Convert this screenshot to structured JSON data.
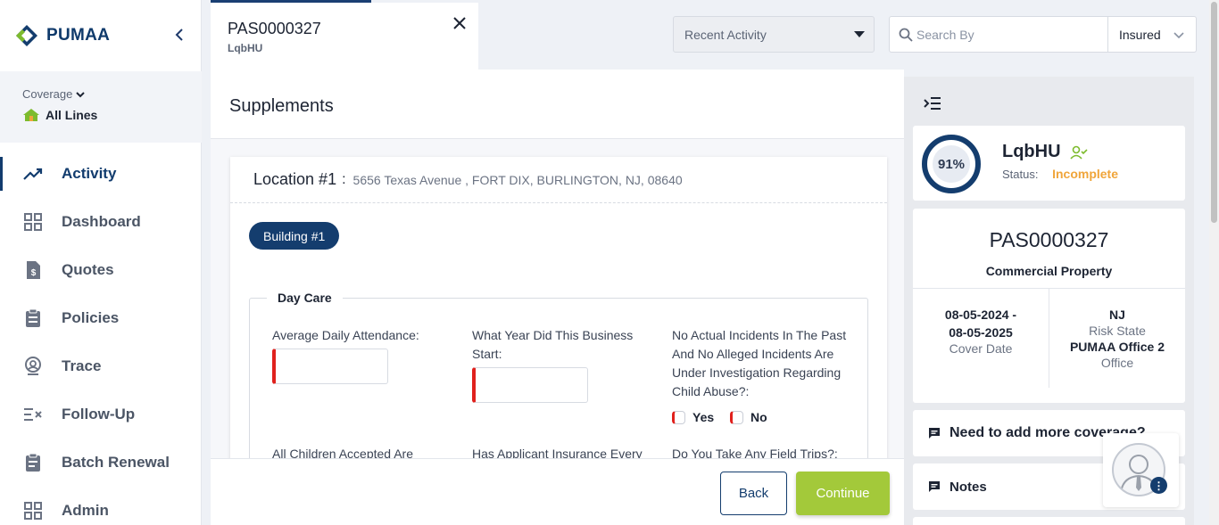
{
  "brand": {
    "name": "PUMAA",
    "colors": {
      "primary": "#143d6e",
      "accent": "#a3c93a",
      "required": "#e0211d",
      "status": "#f0a53a"
    }
  },
  "coverage": {
    "label": "Coverage",
    "value": "All Lines"
  },
  "nav": [
    {
      "label": "Activity",
      "icon": "trend-icon",
      "active": true
    },
    {
      "label": "Dashboard",
      "icon": "grid-icon"
    },
    {
      "label": "Quotes",
      "icon": "document-dollar-icon"
    },
    {
      "label": "Policies",
      "icon": "clipboard-icon"
    },
    {
      "label": "Trace",
      "icon": "location-pin-icon"
    },
    {
      "label": "Follow-Up",
      "icon": "list-check-icon"
    },
    {
      "label": "Batch Renewal",
      "icon": "clipboard-list-icon"
    },
    {
      "label": "Admin",
      "icon": "grid-icon"
    }
  ],
  "tab": {
    "title": "PAS0000327",
    "subtitle": "LqbHU"
  },
  "header": {
    "recent_activity": "Recent Activity",
    "search_placeholder": "Search By",
    "search_type": "Insured"
  },
  "main": {
    "title": "Supplements",
    "location_label": "Location #1",
    "location_colon": ":",
    "location_address": "5656 Texas Avenue , FORT DIX, BURLINGTON, NJ, 08640",
    "building": "Building #1",
    "section": "Day Care",
    "questions": {
      "q1": "Average Daily Attendance:",
      "q2": "What Year Did This Business Start:",
      "q3": "No Actual Incidents In The Past And No Alleged Incidents Are Under Investigation Regarding Child Abuse?:",
      "q4": "All Children Accepted Are",
      "q5": "Has Applicant Insurance Every",
      "q6": "Do You Take Any Field Trips?:"
    },
    "radio_yes": "Yes",
    "radio_no": "No",
    "back": "Back",
    "continue": "Continue"
  },
  "panel": {
    "progress": "91%",
    "name": "LqbHU",
    "status_label": "Status:",
    "status_value": "Incomplete",
    "policy_number": "PAS0000327",
    "line": "Commercial Property",
    "dates_start": "08-05-2024 -",
    "dates_end": "08-05-2025",
    "dates_label": "Cover Date",
    "state": "NJ",
    "state_label": "Risk State",
    "office": "PUMAA Office 2",
    "office_label": "Office",
    "add_coverage": "Need to add more coverage?",
    "notes": "Notes"
  }
}
